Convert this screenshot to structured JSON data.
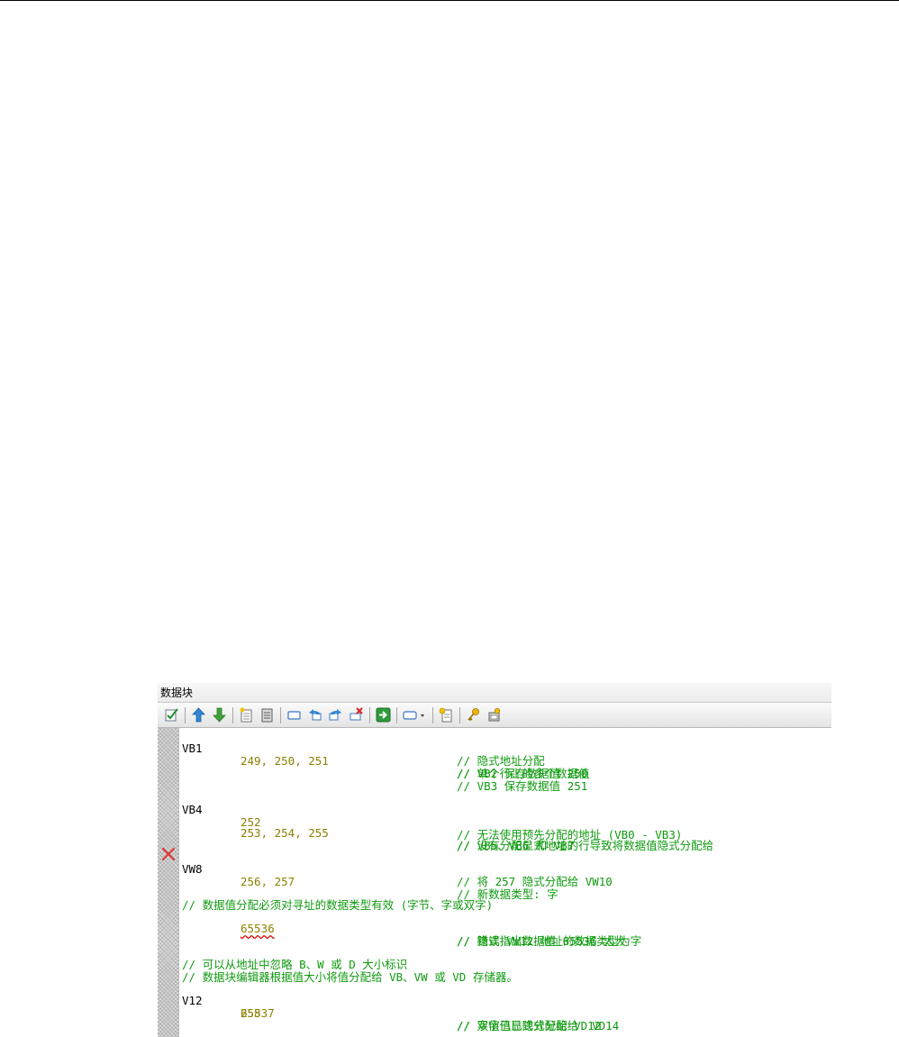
{
  "panel": {
    "title": "数据块"
  },
  "toolbar": {
    "buttons": [
      {
        "name": "compile-check-icon"
      },
      {
        "name": "move-up-arrow-icon"
      },
      {
        "name": "move-down-arrow-icon"
      },
      {
        "name": "insert-page-icon"
      },
      {
        "name": "delete-page-icon"
      },
      {
        "name": "block-icon"
      },
      {
        "name": "undo-icon"
      },
      {
        "name": "redo-icon"
      },
      {
        "name": "clear-icon"
      },
      {
        "name": "go-to-icon"
      },
      {
        "name": "tag-dropdown-icon"
      },
      {
        "name": "properties-icon"
      },
      {
        "name": "key-icon"
      },
      {
        "name": "protect-icon"
      }
    ]
  },
  "gutter": {
    "error_marker_icon": "red-x-icon",
    "error_color": "#e23b3b"
  },
  "colors": {
    "address": "#000000",
    "value": "#8b8000",
    "comment": "#0f9a0f",
    "error_underline": "#d00000"
  },
  "lines": {
    "l1": {
      "addr": "VB1",
      "val": "249, 250, 251",
      "cmt": "// 单个行上的多个数据值"
    },
    "l2": {
      "cmt": "// 隐式地址分配"
    },
    "l3": {
      "cmt": "// VB2 保存数据值 250"
    },
    "l4": {
      "cmt": "// VB3 保存数据值 251"
    },
    "l5": {
      "addr": "VB4",
      "val": "252",
      "cmt": "// 无法使用预先分配的地址 (VB0 - VB3)"
    },
    "l6": {
      "val": "253, 254, 255",
      "cmt": "// 没有分配显式地址的行导致将数据值隐式分配给"
    },
    "l7": {
      "cmt": "// VB5、VB6 和 VB7"
    },
    "l8": {
      "addr": "VW8",
      "val": "256, 257",
      "cmt": "// 新数据类型: 字"
    },
    "l9": {
      "cmt": "// 将 257 隐式分配给 VW10"
    },
    "l10": {
      "cmt": "// 数据值分配必须对寻址的数据类型有效 (字节、字或双字)"
    },
    "l11": {
      "val": "65536",
      "cmt": "// 错误指出数据值 65536 太大"
    },
    "l12": {
      "cmt": "// 隐式 VW12 地址的数据类型为字"
    },
    "l13": {
      "cmt": "// 可以从地址中忽略 B、W 或 D 大小标识"
    },
    "l14": {
      "cmt": "// 数据块编辑器根据值大小将值分配给 VB、VW 或 VD 存储器。"
    },
    "l15": {
      "addr": "V12",
      "val": "258",
      "cmt": "// 字值已显式分配给 VD12"
    },
    "l16": {
      "val": "65537",
      "cmt": "// 双字值已隐式分配给  VD14"
    }
  }
}
